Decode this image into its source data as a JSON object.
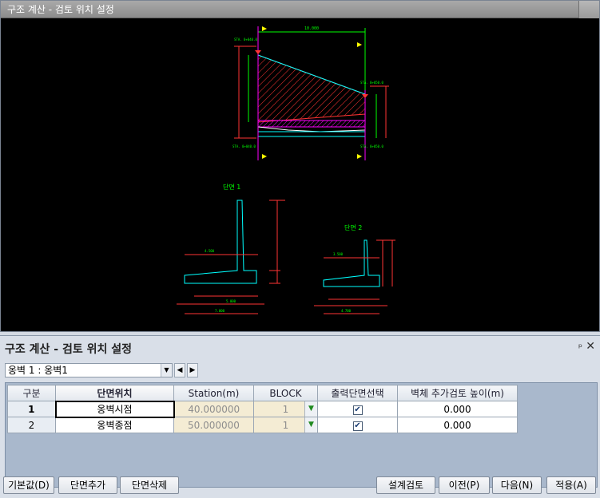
{
  "viewport": {
    "title": "구조 계산 - 검토 위치 설정",
    "section1_label": "단면 1",
    "section2_label": "단면 2"
  },
  "panel": {
    "title": "구조 계산 - 검토 위치 설정",
    "pin_icon": "pin-icon",
    "close_icon": "close-icon"
  },
  "wall_select": {
    "value": "옹벽 1 : 옹벽1"
  },
  "table": {
    "headers": [
      "구분",
      "단면위치",
      "Station(m)",
      "BLOCK",
      "출력단면선택",
      "벽체 추가검토 높이(m)"
    ],
    "rows": [
      {
        "no": "1",
        "position": "옹벽시점",
        "station": "40.000000",
        "block": "1",
        "output": true,
        "height": "0.000"
      },
      {
        "no": "2",
        "position": "옹벽종점",
        "station": "50.000000",
        "block": "1",
        "output": true,
        "height": "0.000"
      }
    ]
  },
  "buttons": {
    "default": "기본값(D)",
    "add_section": "단면추가",
    "delete_section": "단면삭제",
    "design_review": "설계검토",
    "prev": "이전(P)",
    "next": "다음(N)",
    "apply": "적용(A)"
  },
  "colors": {
    "cad_background": "#000000",
    "dimension_green": "#00ff00",
    "outline_cyan": "#00ffff",
    "hatch_red": "#ff3333",
    "marker_yellow": "#ffff00",
    "marker_magenta": "#ff00ff"
  }
}
